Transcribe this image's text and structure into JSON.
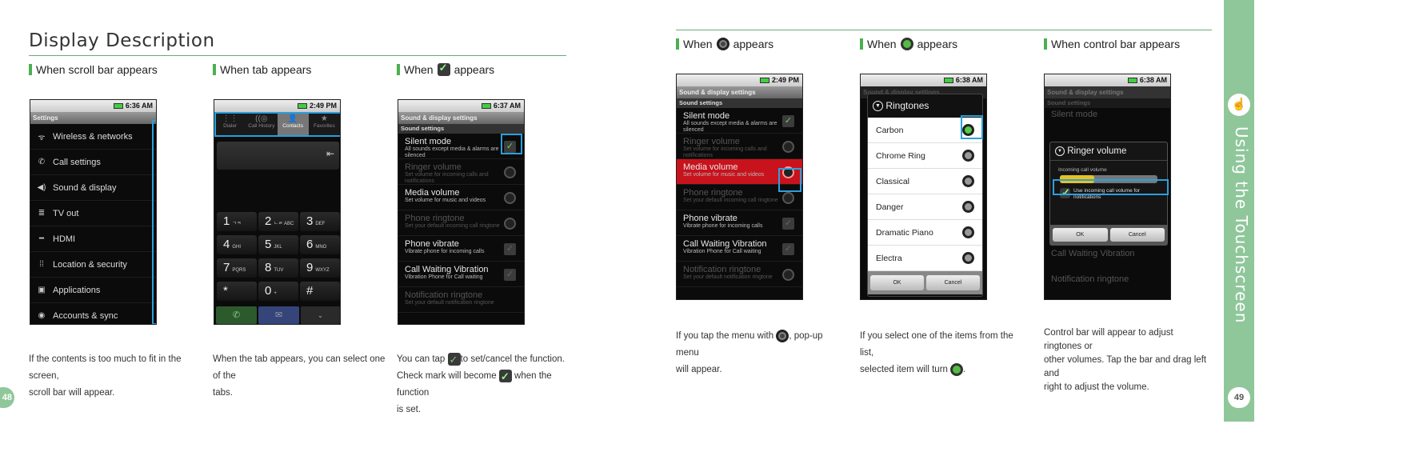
{
  "left_page": {
    "title": "Display Description",
    "page_number": "48",
    "sections": [
      {
        "heading": "When scroll bar appears",
        "caption": [
          "If the contents is  too much to fit in the screen,",
          "scroll bar will appear."
        ]
      },
      {
        "heading": "When tab appears",
        "caption": [
          "When the tab appears, you can select one of the",
          "tabs."
        ]
      },
      {
        "heading_before": "When",
        "heading_after": "appears",
        "heading_icon": "checkbox-icon",
        "caption": [
          "You can tap",
          "to set/cancel the function.",
          "Check mark will become",
          "when the function",
          "is set."
        ]
      }
    ]
  },
  "right_page": {
    "page_number": "49",
    "sidebar_title": "Using the Touchscreen",
    "sidebar_icon": "touch-hand-icon",
    "sections": [
      {
        "heading_before": "When",
        "heading_after": "appears",
        "heading_icon": "radio-grey-icon",
        "caption": [
          "If you tap the menu with",
          ", pop-up menu",
          "will appear."
        ]
      },
      {
        "heading_before": "When",
        "heading_after": "appears",
        "heading_icon": "radio-green-icon",
        "caption": [
          "If you select one of the items from the list,",
          "selected item will turn",
          "."
        ]
      },
      {
        "heading": "When control bar appears",
        "caption": [
          "Control bar will appear to adjust ringtones or",
          "other volumes. Tap the bar and drag left and",
          "right to adjust the volume."
        ]
      }
    ]
  },
  "screens": {
    "settings": {
      "time": "6:36 AM",
      "title": "Settings",
      "items": [
        "Wireless & networks",
        "Call settings",
        "Sound & display",
        "TV out",
        "HDMI",
        "Location & security",
        "Applications",
        "Accounts & sync"
      ],
      "icons": [
        "wifi-icon",
        "phone-icon",
        "speaker-icon",
        "tv-icon",
        "hdmi-icon",
        "grid-icon",
        "applications-icon",
        "sync-icon"
      ]
    },
    "dialer": {
      "time": "2:49 PM",
      "tabs": [
        "Dialer",
        "Call History",
        "Contacts",
        "Favorites"
      ],
      "keys": [
        [
          "1",
          "ㄱㅋ"
        ],
        [
          "2",
          "ㄴㄹ ABC"
        ],
        [
          "3",
          "DEF"
        ],
        [
          "4",
          "GHI"
        ],
        [
          "5",
          "JKL"
        ],
        [
          "6",
          "MNO"
        ],
        [
          "7",
          "PQRS"
        ],
        [
          "8",
          "TUV"
        ],
        [
          "9",
          "WXYZ"
        ],
        [
          "*",
          ""
        ],
        [
          "0",
          "+"
        ],
        [
          "#",
          ""
        ]
      ]
    },
    "sound_a": {
      "time": "6:37 AM",
      "title": "Sound & display settings",
      "subtitle": "Sound settings",
      "items": [
        {
          "t": "Silent mode",
          "s": "All sounds except media & alarms are silenced",
          "w": "check-on",
          "dim": false
        },
        {
          "t": "Ringer volume",
          "s": "Set volume for incoming calls and notifications",
          "w": "radio",
          "dim": true
        },
        {
          "t": "Media volume",
          "s": "Set volume for music and videos",
          "w": "radio",
          "dim": false
        },
        {
          "t": "Phone ringtone",
          "s": "Set your default incoming call ringtone",
          "w": "radio",
          "dim": true
        },
        {
          "t": "Phone vibrate",
          "s": "Vibrate phone for incoming calls",
          "w": "check",
          "dim": false
        },
        {
          "t": "Call Waiting Vibration",
          "s": "Vibration Phone for Call waiting",
          "w": "check",
          "dim": false
        },
        {
          "t": "Notification ringtone",
          "s": "Set your default notification ringtone",
          "w": "",
          "dim": true
        }
      ]
    },
    "sound_b": {
      "time": "2:49 PM",
      "title": "Sound & display settings",
      "subtitle": "Sound settings",
      "items": [
        {
          "t": "Silent mode",
          "s": "All sounds except media & alarms are silenced",
          "w": "check-on",
          "dim": false
        },
        {
          "t": "Ringer volume",
          "s": "Set volume for incoming calls and notifications",
          "w": "radio",
          "dim": true
        },
        {
          "t": "Media volume",
          "s": "Set volume for music and videos",
          "w": "radio",
          "dim": false,
          "hl": true
        },
        {
          "t": "Phone ringtone",
          "s": "Set your default incoming call ringtone",
          "w": "radio",
          "dim": true
        },
        {
          "t": "Phone vibrate",
          "s": "Vibrate phone for incoming calls",
          "w": "check",
          "dim": false
        },
        {
          "t": "Call Waiting Vibration",
          "s": "Vibration Phone for Call waiting",
          "w": "check",
          "dim": false
        },
        {
          "t": "Notification ringtone",
          "s": "Set your default notification ringtone",
          "w": "radio",
          "dim": true
        }
      ]
    },
    "ringtones": {
      "time": "6:38 AM",
      "bg_title": "Sound & display settings",
      "dialog_title": "Ringtones",
      "items": [
        "Carbon",
        "Chrome Ring",
        "Classical",
        "Danger",
        "Dramatic Piano",
        "Electra"
      ],
      "selected": 0,
      "ok": "OK",
      "cancel": "Cancel"
    },
    "ringer": {
      "time": "6:38 AM",
      "bg_title": "Sound & display settings",
      "subtitle": "Sound settings",
      "bg_items": [
        "Silent mode",
        "Call Waiting Vibration",
        "Notification ringtone"
      ],
      "dialog_title": "Ringer volume",
      "label": "Incoming call volume",
      "volume_percent": 35,
      "checkbox_label": "Use incoming call volume for notifications",
      "ok": "OK",
      "cancel": "Cancel"
    }
  },
  "colors": {
    "accent_green": "#4caf50",
    "highlight_blue": "#2aa0dd",
    "sidebar": "#8fc79a"
  }
}
